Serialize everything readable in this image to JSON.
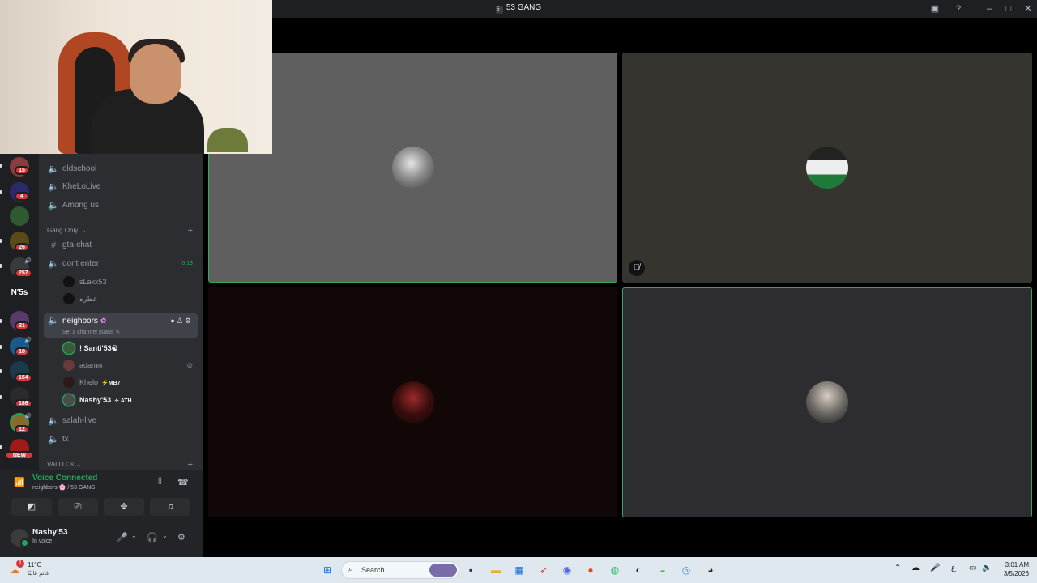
{
  "window": {
    "title": "53 GANG",
    "server_glyph": "5↑"
  },
  "servers": [
    {
      "badge": "15"
    },
    {
      "badge": "4"
    },
    {
      "badge": ""
    },
    {
      "badge": "26"
    },
    {
      "badge": "257"
    },
    {
      "label": "N'5s",
      "badge": ""
    },
    {
      "badge": "31"
    },
    {
      "badge": "18"
    },
    {
      "badge": "154"
    },
    {
      "badge": "186"
    },
    {
      "badge": "12"
    },
    {
      "badge": "NEW"
    }
  ],
  "channels": {
    "top": [
      {
        "name": "oldschool"
      },
      {
        "name": "KheLoLive"
      },
      {
        "name": "Among us"
      }
    ],
    "category_gang": "Gang Only.",
    "gta_chat": "gta-chat",
    "dont_enter": {
      "name": "dont enter",
      "timer": "0:13"
    },
    "dont_enter_members": [
      "sLaxx53",
      "عطره"
    ],
    "neighbors": {
      "name": "neighbors",
      "status": "Set a channel status"
    },
    "neighbors_members": [
      {
        "name": "! Santi'53",
        "suffix": "☯",
        "tag": ""
      },
      {
        "name": "adam",
        "suffix": "㎃",
        "tag": ""
      },
      {
        "name": "Khelo",
        "suffix": "",
        "tag": "⚡MB7"
      },
      {
        "name": "Nashy'53",
        "suffix": "",
        "tag": "✧ ATH"
      }
    ],
    "salah_live": "salah-live",
    "tx": "tx",
    "category_valo": "VALO Os"
  },
  "voice": {
    "status": "Voice Connected",
    "location": "neighbors 🌸 / 53 GANG"
  },
  "user": {
    "name": "Nashy'53",
    "status": "In voice"
  },
  "taskbar": {
    "weather_temp": "11°C",
    "weather_desc": "غائم غالبًا",
    "weather_badge": "1",
    "search_placeholder": "Search",
    "time": "3:01 AM",
    "date": "3/5/2026",
    "lang": "ع"
  },
  "colors": {
    "speaking_border": "#3ba55c",
    "voice_green": "#23a559",
    "badge_red": "#da373c"
  }
}
